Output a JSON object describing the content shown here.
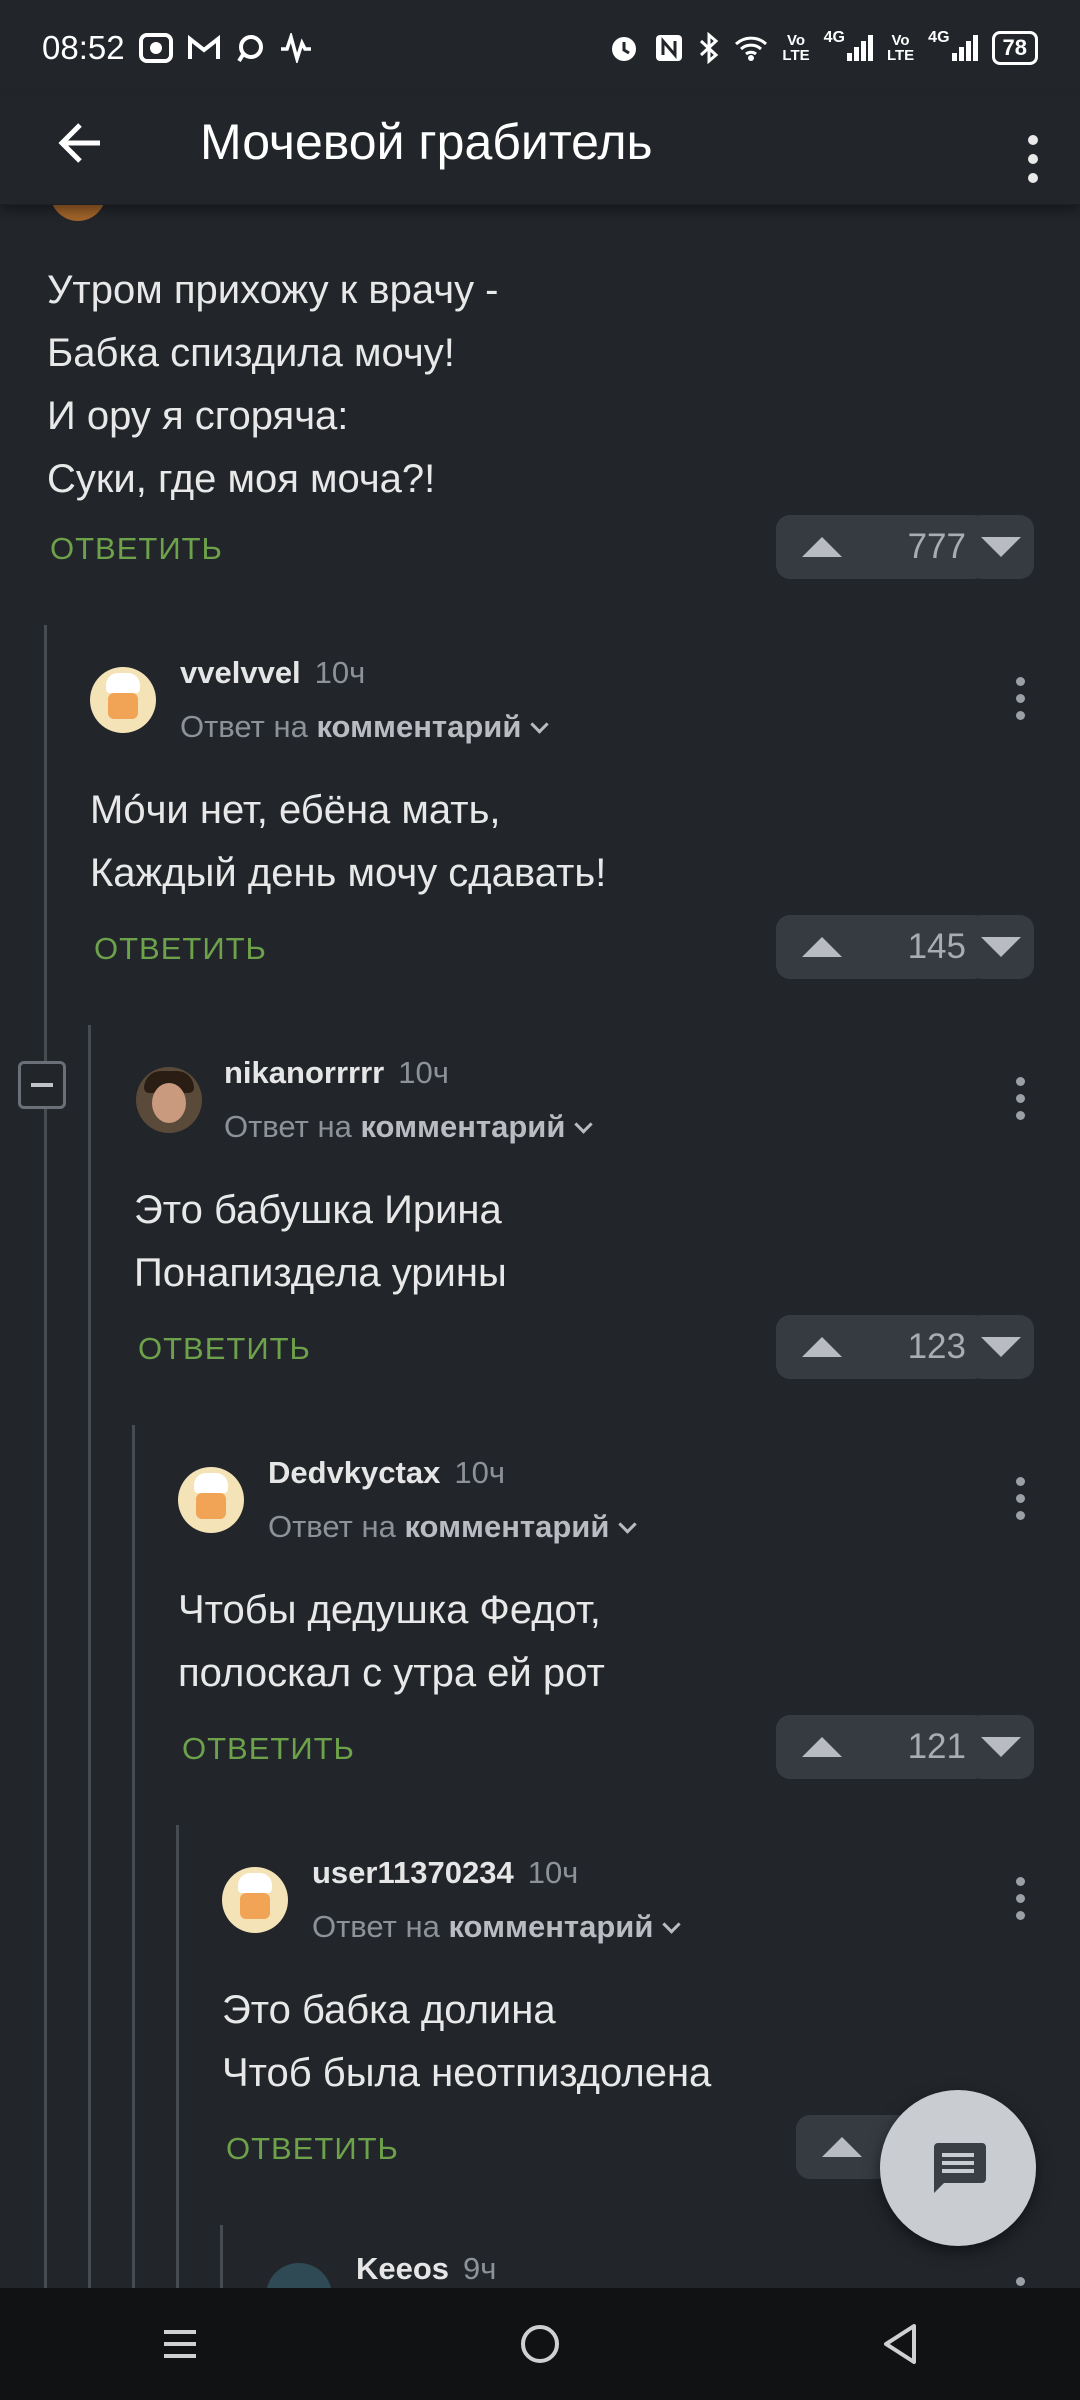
{
  "status_bar": {
    "time": "08:52",
    "left_icons": [
      "gallery-icon",
      "gmail-icon",
      "chat-icon",
      "audio-wave-icon"
    ],
    "right_icons": [
      "alarm-icon",
      "nfc-icon",
      "bluetooth-icon",
      "wifi-icon",
      "volte-icon",
      "signal-icon"
    ],
    "volte1": "Vo\nLTE",
    "g1": "4G",
    "volte2": "Vo\nLTE",
    "g2": "4G",
    "battery": "78"
  },
  "app_bar": {
    "title": "Мочевой грабитель"
  },
  "comments": [
    {
      "text": "Утром прихожу к врачу -\nБабка спиздила мочу!\nИ ору я сгоряча:\nСуки, где моя моча?!",
      "reply_label": "ОТВЕТИТЬ",
      "votes": "777"
    },
    {
      "user": "vvelvvel",
      "time": "10ч",
      "meta_prefix": "Ответ на",
      "meta_link": "комментарий",
      "text": "Мóчи нет, ебёна мать,\nКаждый день мочу сдавать!",
      "reply_label": "ОТВЕТИТЬ",
      "votes": "145"
    },
    {
      "user": "nikanorrrrr",
      "time": "10ч",
      "meta_prefix": "Ответ на",
      "meta_link": "комментарий",
      "text": "Это бабушка Ирина\nПонапиздела урины",
      "reply_label": "ОТВЕТИТЬ",
      "votes": "123"
    },
    {
      "user": "Dedvkyctax",
      "time": "10ч",
      "meta_prefix": "Ответ на",
      "meta_link": "комментарий",
      "text": "Чтобы дедушка Федот,\nполоскал с утра ей рот",
      "reply_label": "ОТВЕТИТЬ",
      "votes": "121"
    },
    {
      "user": "user11370234",
      "time": "10ч",
      "meta_prefix": "Ответ на",
      "meta_link": "комментарий",
      "text": "Это бабка долина\nЧтоб была неотпиздолена",
      "reply_label": "ОТВЕТИТЬ"
    },
    {
      "user": "Keeos",
      "time": "9ч"
    }
  ],
  "fab": {
    "icon": "comment-icon"
  },
  "nav": {
    "icons": [
      "recents-icon",
      "home-icon",
      "back-nav-icon"
    ]
  }
}
